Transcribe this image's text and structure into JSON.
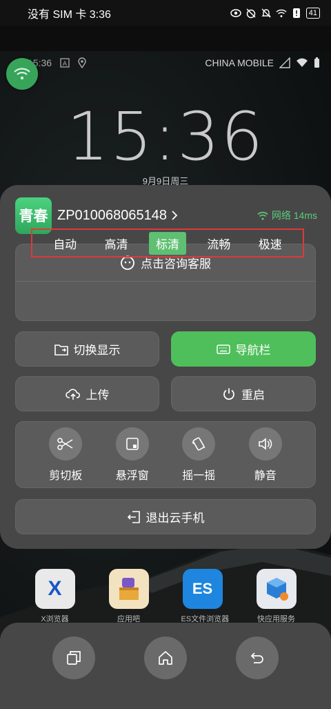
{
  "statusbar": {
    "carrier_time": "没有 SIM 卡 3:36",
    "battery": "41",
    "icons": [
      "eye-icon",
      "alarm-off-icon",
      "bell-off-icon",
      "wifi-icon",
      "alert-icon",
      "battery-icon"
    ]
  },
  "remote_screen": {
    "status_time": "15:36",
    "carrier": "CHINA MOBILE",
    "clock": "15:36",
    "date": "9月9日周三",
    "apps": [
      {
        "name": "X浏览器",
        "color": "#e9e9ea",
        "glyph": "X",
        "glyph_color": "#1a56c4"
      },
      {
        "name": "应用吧",
        "color": "#f3e2c0",
        "glyph": "",
        "glyph_color": "#b07a2a"
      },
      {
        "name": "ES文件浏览器",
        "color": "#1e86df",
        "glyph": "ES",
        "glyph_color": "#ffffff"
      },
      {
        "name": "快应用服务",
        "color": "#e6e9ee",
        "glyph": "",
        "glyph_color": "#2a7fd4"
      }
    ]
  },
  "panel": {
    "logo_text": "青春",
    "device_id": "ZP010068065148",
    "network_label": "网络 14ms",
    "consult_label": "点击咨询客服",
    "quality_options": [
      "自动",
      "高清",
      "标清",
      "流畅",
      "极速"
    ],
    "quality_selected": "标清",
    "switch_display": "切换显示",
    "nav_bar": "导航栏",
    "upload": "上传",
    "restart": "重启",
    "tools": [
      "剪切板",
      "悬浮窗",
      "摇一摇",
      "静音"
    ],
    "exit": "退出云手机"
  },
  "colors": {
    "accent_green": "#4fbf5b",
    "network_green": "#5ccb7c",
    "highlight_red": "#e0393a"
  }
}
